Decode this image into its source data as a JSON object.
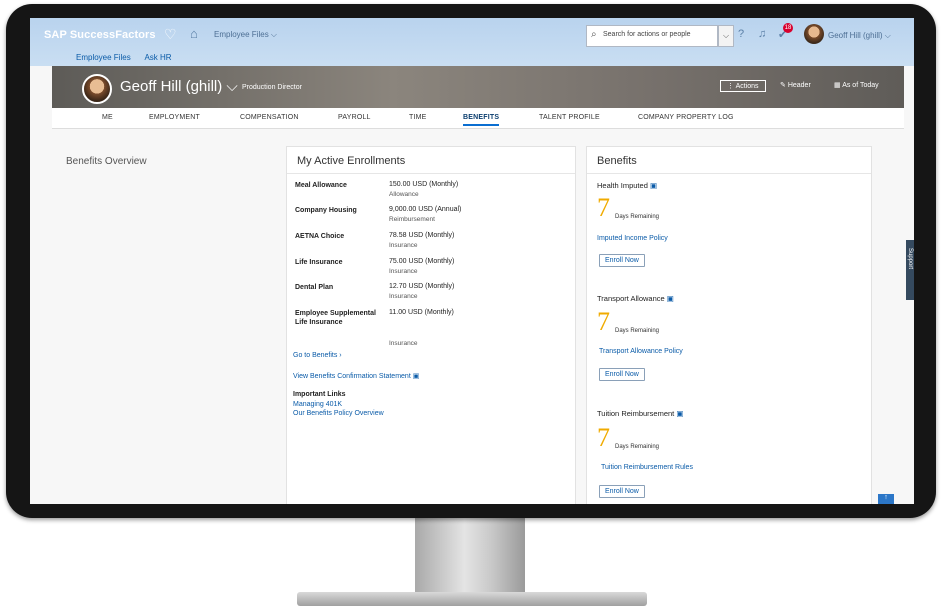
{
  "shell": {
    "brand": "SAP SuccessFactors",
    "nav_menu": "Employee Files ⌵",
    "sub_links": [
      "Employee Files",
      "Ask HR"
    ],
    "search_placeholder": "Search for actions or people",
    "notification_count": "18",
    "user_name": "Geoff Hill (ghill) ⌵"
  },
  "header": {
    "employee_name": "Geoff Hill (ghill) ⌵",
    "employee_title": "Production Director",
    "actions_label": "Actions",
    "header_label": "Header",
    "as_of_label": "As of Today"
  },
  "tabs": [
    "ME",
    "EMPLOYMENT",
    "COMPENSATION",
    "PAYROLL",
    "TIME",
    "BENEFITS",
    "TALENT PROFILE",
    "COMPANY PROPERTY LOG"
  ],
  "active_tab": "BENEFITS",
  "left": {
    "title": "Benefits Overview"
  },
  "enrollments": {
    "title": "My Active Enrollments",
    "items": [
      {
        "label": "Meal Allowance",
        "value": "150.00 USD (Monthly)",
        "type": "Allowance"
      },
      {
        "label": "Company Housing",
        "value": "9,000.00 USD (Annual)",
        "type": "Reimbursement"
      },
      {
        "label": "AETNA Choice",
        "value": "78.58 USD (Monthly)",
        "type": "Insurance"
      },
      {
        "label": "Life Insurance",
        "value": "75.00 USD (Monthly)",
        "type": "Insurance"
      },
      {
        "label": "Dental Plan",
        "value": "12.70 USD (Monthly)",
        "type": "Insurance"
      },
      {
        "label": "Employee Supplemental Life Insurance",
        "value": "11.00 USD (Monthly)",
        "type": "Insurance"
      }
    ],
    "go_to_benefits": "Go to Benefits  ›",
    "confirmation": "View Benefits Confirmation Statement",
    "important_links_title": "Important Links",
    "important_links": [
      "Managing 401K",
      "Our Benefits Policy Overview"
    ]
  },
  "benefits": {
    "title": "Benefits",
    "items": [
      {
        "name": "Health Imputed",
        "days": "7",
        "days_label": "Days Remaining",
        "policy": "Imputed Income Policy",
        "button": "Enroll Now"
      },
      {
        "name": "Transport Allowance",
        "days": "7",
        "days_label": "Days Remaining",
        "policy": "Transport Allowance Policy",
        "button": "Enroll Now"
      },
      {
        "name": "Tuition Reimbursement",
        "days": "7",
        "days_label": "Days Remaining",
        "policy": "Tuition Reimbursement Rules",
        "button": "Enroll Now"
      }
    ]
  },
  "support_label": "Support"
}
